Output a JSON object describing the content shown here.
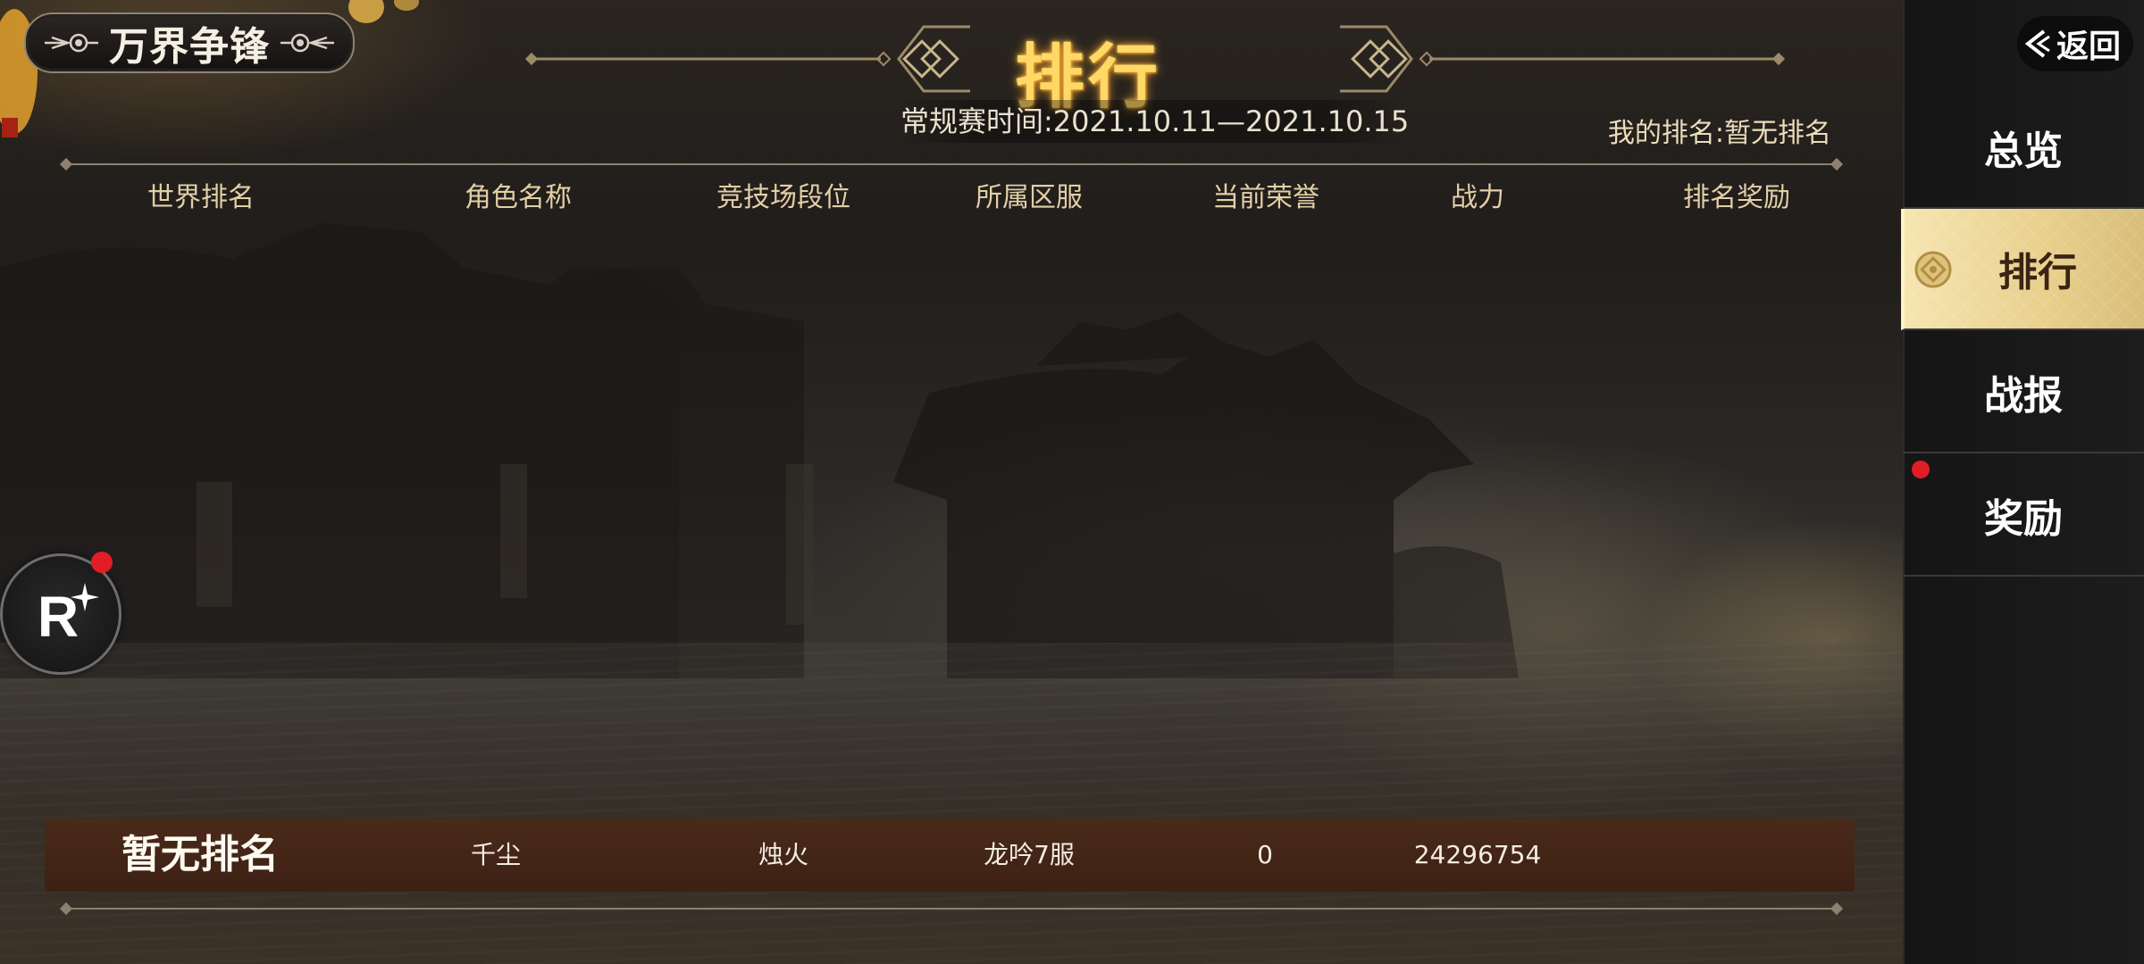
{
  "event": {
    "title": "万界争锋"
  },
  "page": {
    "title": "排行",
    "season_time": "常规赛时间:2021.10.11—2021.10.15",
    "my_rank": "我的排名:暂无排名"
  },
  "table": {
    "headers": [
      "世界排名",
      "角色名称",
      "竞技场段位",
      "所属区服",
      "当前荣誉",
      "战力",
      "排名奖励"
    ],
    "my_row": {
      "rank": "暂无排名",
      "name": "千尘",
      "tier": "烛火",
      "server": "龙吟7服",
      "honor": "0",
      "power": "24296754",
      "reward": ""
    }
  },
  "sidebar": {
    "back_label": "返回",
    "items": [
      {
        "label": "总览",
        "active": false,
        "badge": false
      },
      {
        "label": "排行",
        "active": true,
        "badge": false
      },
      {
        "label": "战报",
        "active": false,
        "badge": false
      },
      {
        "label": "奖励",
        "active": false,
        "badge": true
      }
    ]
  },
  "float_button": {
    "label": "R",
    "badge": true
  },
  "colors": {
    "title_gold": "#ffd866",
    "header_text": "#e2cfa6",
    "row_bg": "#4a2a1a",
    "active_tab": "#f6e5b0",
    "badge_red": "#e11d26"
  }
}
